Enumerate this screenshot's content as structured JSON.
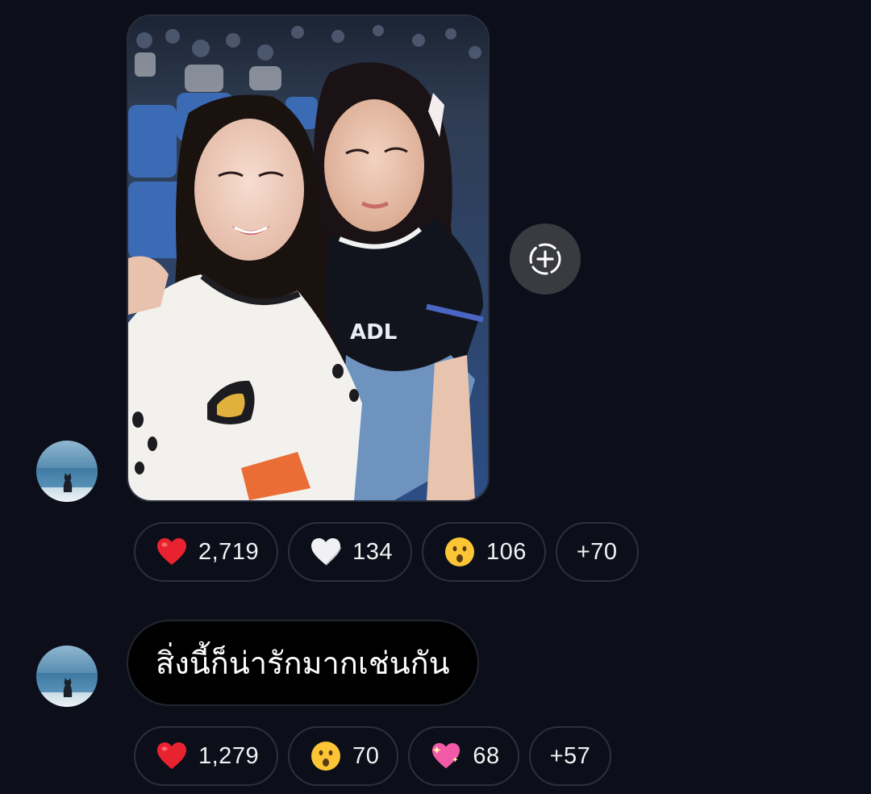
{
  "messages": [
    {
      "type": "image",
      "reactions": [
        {
          "emoji": "red-heart",
          "count": "2,719"
        },
        {
          "emoji": "white-heart",
          "count": "134"
        },
        {
          "emoji": "astonished-face",
          "count": "106"
        },
        {
          "emoji": null,
          "count": "+70"
        }
      ]
    },
    {
      "type": "text",
      "text": "สิ่งนี้ก็น่ารักมากเช่นกัน",
      "reactions": [
        {
          "emoji": "red-heart",
          "count": "1,279"
        },
        {
          "emoji": "astonished-face",
          "count": "70"
        },
        {
          "emoji": "sparkling-heart",
          "count": "68"
        },
        {
          "emoji": null,
          "count": "+57"
        }
      ]
    }
  ],
  "icons": {
    "share": "add-to-story-icon"
  },
  "colors": {
    "background": "#0c0f1a",
    "pill_border": "#2c303c",
    "share_button_bg": "#3a3b41",
    "bubble_bg": "#000000"
  }
}
